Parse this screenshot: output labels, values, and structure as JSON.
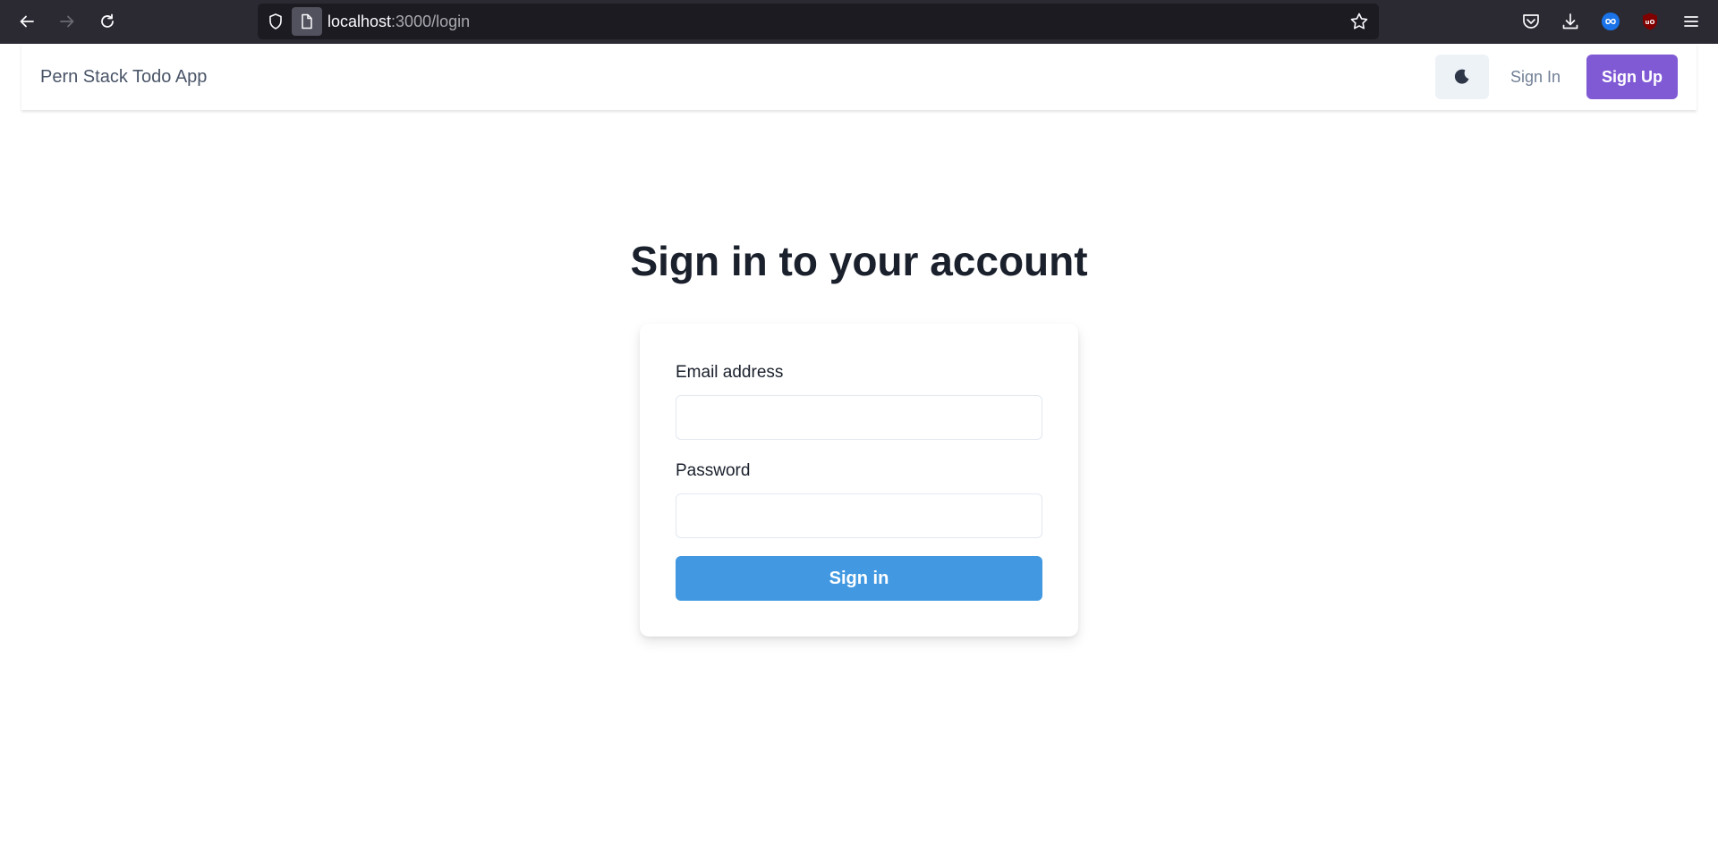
{
  "browser": {
    "url_host": "localhost",
    "url_path": ":3000/login",
    "icons": {
      "back": "back-arrow-icon",
      "forward": "forward-arrow-icon",
      "reload": "reload-icon",
      "shield": "shield-icon",
      "page": "page-icon",
      "bookmark": "star-icon",
      "pocket": "pocket-icon",
      "downloads": "download-icon",
      "extension_1": "infinity-extension-icon",
      "extension_2": "ublock-shield-icon",
      "menu": "hamburger-menu-icon"
    }
  },
  "navbar": {
    "brand": "Pern Stack Todo App",
    "theme_toggle_icon": "moon-icon",
    "signin_label": "Sign In",
    "signup_label": "Sign Up"
  },
  "login": {
    "heading": "Sign in to your account",
    "email_label": "Email address",
    "email_value": "",
    "password_label": "Password",
    "password_value": "",
    "submit_label": "Sign in"
  },
  "colors": {
    "primary": "#4299e1",
    "accent": "#805ad5",
    "browser_bg": "#2b2a33"
  }
}
